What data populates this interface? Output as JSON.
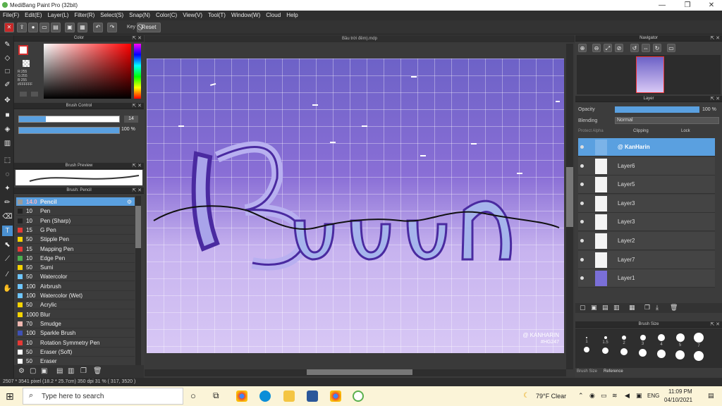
{
  "window": {
    "title": "MediBang Paint Pro (32bit)",
    "minimize": "—",
    "maximize": "❐",
    "close": "✕"
  },
  "menu": [
    "File(F)",
    "Edit(E)",
    "Layer(L)",
    "Filter(R)",
    "Select(S)",
    "Snap(N)",
    "Color(C)",
    "View(V)",
    "Tool(T)",
    "Window(W)",
    "Cloud",
    "Help"
  ],
  "toolbar": {
    "key_label": "Key",
    "reset_label": "Reset"
  },
  "color_panel": {
    "title": "Color",
    "r": "R:255",
    "g": "G:255",
    "b": "B:255",
    "hex": "#FFFFFF"
  },
  "brush_control": {
    "title": "Brush Control",
    "size": "14",
    "opacity": "100 %"
  },
  "brush_preview": {
    "title": "Brush Preview"
  },
  "brush_list": {
    "title": "Brush: Pencil",
    "items": [
      {
        "size": "14.0",
        "name": "Pencil",
        "color": "#9a9a9a"
      },
      {
        "size": "10",
        "name": "Pen",
        "color": "#222222"
      },
      {
        "size": "10",
        "name": "Pen (Sharp)",
        "color": "#222222"
      },
      {
        "size": "15",
        "name": "G Pen",
        "color": "#e53935"
      },
      {
        "size": "50",
        "name": "Stipple Pen",
        "color": "#f5d300"
      },
      {
        "size": "15",
        "name": "Mapping Pen",
        "color": "#e53935"
      },
      {
        "size": "10",
        "name": "Edge Pen",
        "color": "#4caf50"
      },
      {
        "size": "50",
        "name": "Sumi",
        "color": "#f5d300"
      },
      {
        "size": "50",
        "name": "Watercolor",
        "color": "#6ec6ff"
      },
      {
        "size": "100",
        "name": "Airbrush",
        "color": "#6ec6ff"
      },
      {
        "size": "100",
        "name": "Watercolor (Wet)",
        "color": "#6ec6ff"
      },
      {
        "size": "50",
        "name": "Acrylic",
        "color": "#f5d300"
      },
      {
        "size": "1000",
        "name": "Blur",
        "color": "#f5d300"
      },
      {
        "size": "70",
        "name": "Smudge",
        "color": "#f0b8b0"
      },
      {
        "size": "100",
        "name": "Sparkle Brush",
        "color": "#3f51b5"
      },
      {
        "size": "10",
        "name": "Rotation Symmetry Pen",
        "color": "#e53935"
      },
      {
        "size": "50",
        "name": "Eraser (Soft)",
        "color": "#ffffff"
      },
      {
        "size": "50",
        "name": "Eraser",
        "color": "#ffffff"
      }
    ]
  },
  "document": {
    "tab": "Bầu trời đêm).mdp",
    "watermark_line1": "@ KANHARIN",
    "watermark_line2": "#HG247"
  },
  "navigator": {
    "title": "Navigator"
  },
  "layer_panel": {
    "title": "Layer",
    "opacity_label": "Opacity",
    "opacity_value": "100 %",
    "blending_label": "Blending",
    "blending_value": "Normal",
    "protect_alpha": "Protect Alpha",
    "clipping": "Clipping",
    "lock": "Lock",
    "layers": [
      "@ KanHarin",
      "Layer6",
      "Layer5",
      "Layer3",
      "Layer3",
      "Layer2",
      "Layer7",
      "Layer1"
    ]
  },
  "brush_size_panel": {
    "title": "Brush Size",
    "sizes": [
      "1",
      "1.5",
      "2",
      "3",
      "4",
      "5",
      "7"
    ],
    "tabs": [
      "Brush Size",
      "Reference"
    ]
  },
  "status": {
    "text": "2507 * 3541 pixel    (18.2 * 25.7cm)    350 dpi    31 %    ( 317, 3520 )"
  },
  "taskbar": {
    "search_placeholder": "Type here to search",
    "weather": "79°F  Clear",
    "lang": "ENG",
    "time": "11:09 PM",
    "date": "04/10/2021"
  }
}
